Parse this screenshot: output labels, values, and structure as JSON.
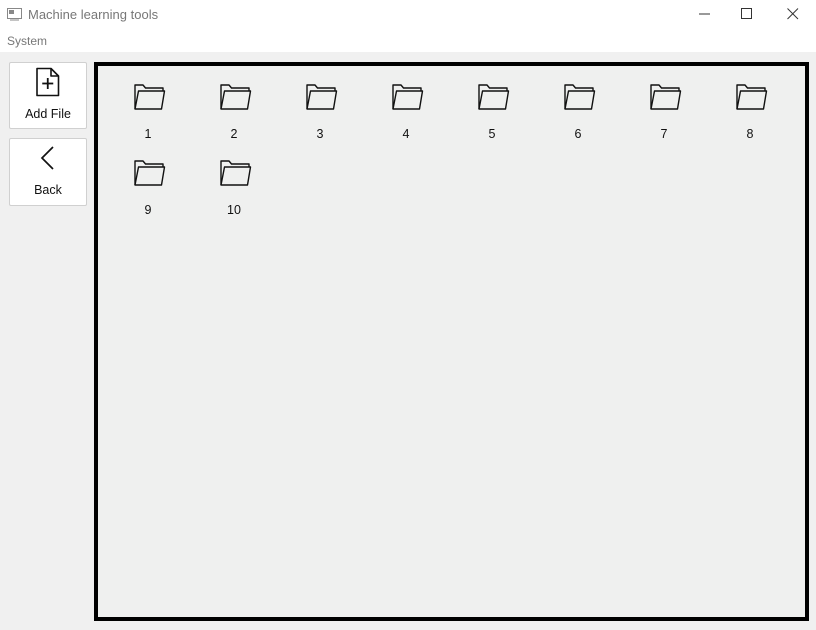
{
  "window": {
    "title": "Machine learning tools",
    "icon": "app-window-icon",
    "controls": [
      "minimize-icon",
      "maximize-icon",
      "close-icon"
    ]
  },
  "menu": {
    "items": [
      "System"
    ]
  },
  "toolbar": {
    "add_file_label": "Add File",
    "add_file_icon": "file-plus-icon",
    "back_label": "Back",
    "back_icon": "chevron-left-icon"
  },
  "folders": [
    {
      "label": "1",
      "icon": "folder-icon"
    },
    {
      "label": "2",
      "icon": "folder-icon"
    },
    {
      "label": "3",
      "icon": "folder-icon"
    },
    {
      "label": "4",
      "icon": "folder-icon"
    },
    {
      "label": "5",
      "icon": "folder-icon"
    },
    {
      "label": "6",
      "icon": "folder-icon"
    },
    {
      "label": "7",
      "icon": "folder-icon"
    },
    {
      "label": "8",
      "icon": "folder-icon"
    },
    {
      "label": "9",
      "icon": "folder-icon"
    },
    {
      "label": "10",
      "icon": "folder-icon"
    }
  ],
  "colors": {
    "content_bg": "#eff0ef",
    "content_border": "#000000",
    "title_text": "#777777"
  }
}
